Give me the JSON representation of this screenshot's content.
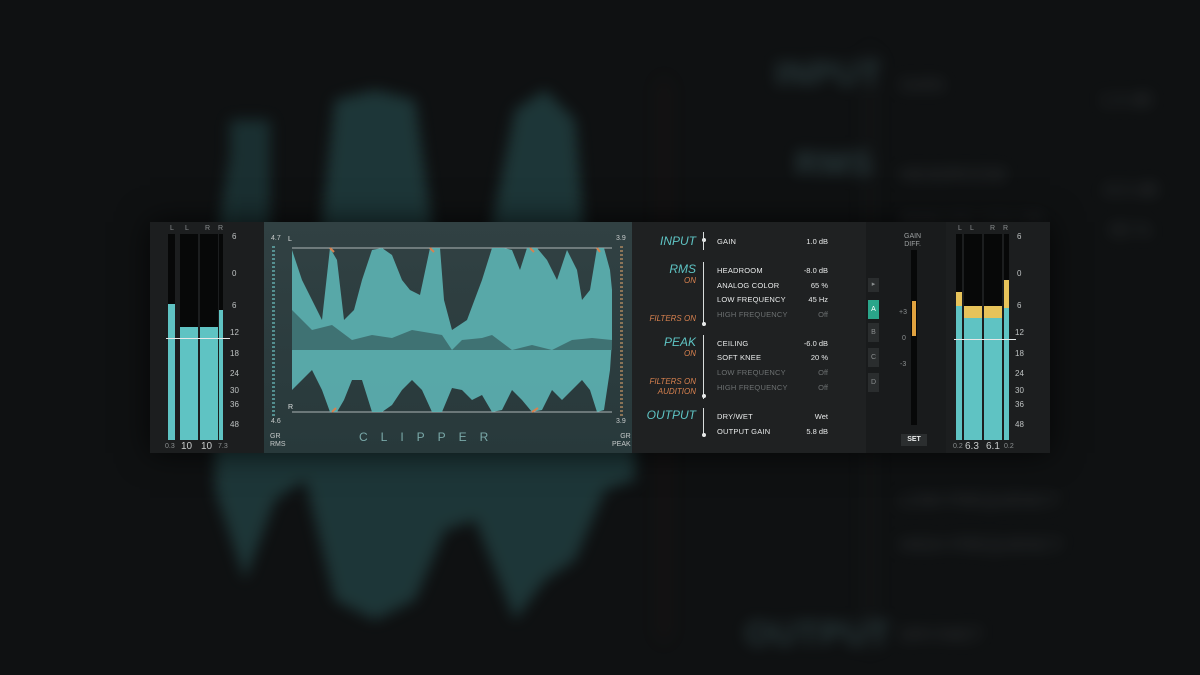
{
  "left_meter": {
    "headers": [
      "L",
      "L",
      "R",
      "R"
    ],
    "scale": [
      "6",
      "0",
      "6",
      "12",
      "18",
      "24",
      "30",
      "36",
      "48"
    ],
    "bottom": {
      "left": "0.3",
      "mid_left": "10",
      "mid_right": "10",
      "right": "7.3"
    },
    "levels": [
      0.62,
      0.55,
      0.55,
      0.6
    ]
  },
  "display": {
    "title": "CLIPPER",
    "left_top": "4.7",
    "left_bottom": "4.6",
    "right_top": "3.9",
    "right_bottom": "3.9",
    "left_label": "GR\nRMS",
    "right_label": "GR\nPEAK",
    "ch_top": "L",
    "ch_bottom": "R",
    "scale": [
      "-3",
      "-6",
      "-12",
      "-24",
      "-24",
      "-12",
      "-6",
      "-3",
      "0"
    ]
  },
  "params": {
    "input": {
      "label": "INPUT",
      "rows": [
        {
          "name": "GAIN",
          "value": "1.0 dB"
        }
      ]
    },
    "rms": {
      "label": "RMS",
      "state": "ON",
      "filters": "FILTERS ON",
      "rows": [
        {
          "name": "HEADROOM",
          "value": "-8.0 dB",
          "dim": false
        },
        {
          "name": "ANALOG COLOR",
          "value": "65 %",
          "dim": false
        },
        {
          "name": "LOW FREQUENCY",
          "value": "45 Hz",
          "dim": false
        },
        {
          "name": "HIGH FREQUENCY",
          "value": "Off",
          "dim": true
        }
      ]
    },
    "peak": {
      "label": "PEAK",
      "state": "ON",
      "filters": "FILTERS ON",
      "audition": "AUDITION",
      "rows": [
        {
          "name": "CEILING",
          "value": "-6.0 dB",
          "dim": false
        },
        {
          "name": "SOFT KNEE",
          "value": "20 %",
          "dim": false
        },
        {
          "name": "LOW FREQUENCY",
          "value": "Off",
          "dim": true
        },
        {
          "name": "HIGH FREQUENCY",
          "value": "Off",
          "dim": true
        }
      ]
    },
    "output": {
      "label": "OUTPUT",
      "rows": [
        {
          "name": "DRY/WET",
          "value": "Wet"
        },
        {
          "name": "OUTPUT GAIN",
          "value": "5.8 dB"
        }
      ]
    }
  },
  "ab": {
    "play": "▸",
    "slots": [
      "A",
      "B",
      "C",
      "D"
    ],
    "selected": "A"
  },
  "gain_diff": {
    "label": "GAIN\nDIFF.",
    "scale": [
      "+3",
      "0",
      "-3"
    ],
    "set": "SET",
    "level": 0.35
  },
  "right_meter": {
    "headers": [
      "L",
      "L",
      "R",
      "R"
    ],
    "scale": [
      "6",
      "0",
      "6",
      "12",
      "18",
      "24",
      "30",
      "36",
      "48"
    ],
    "bottom": {
      "left": "0.2",
      "mid_left": "6.3",
      "mid_right": "6.1",
      "right": "0.2"
    }
  },
  "colors": {
    "accent": "#5ec4c4",
    "orange": "#d7814f",
    "selected": "#2aa58a",
    "yellow": "#e7c35a"
  }
}
